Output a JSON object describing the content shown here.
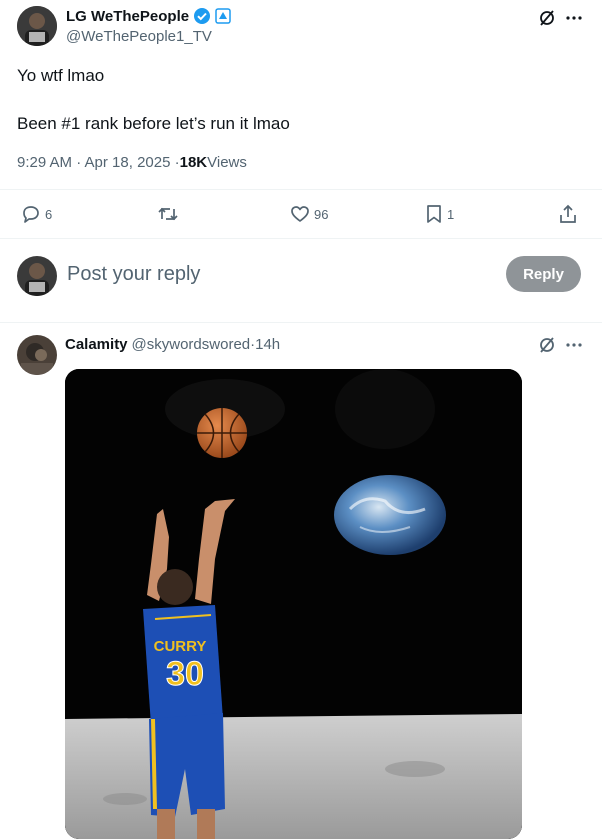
{
  "main_post": {
    "author_name": "LG WeThePeople",
    "author_handle": "@WeThePeople1_TV",
    "line1": "Yo wtf lmao",
    "line2": "Been #1 rank before let’s run it lmao",
    "time": "9:29 AM · Apr 18, 2025 · ",
    "views_count": "18K",
    "views_label": " Views",
    "stats": {
      "replies": "6",
      "likes": "96",
      "bookmarks": "1"
    }
  },
  "reply_box": {
    "placeholder": "Post your reply",
    "button_label": "Reply"
  },
  "reply_post": {
    "author_name": "Calamity",
    "author_handle": "@skywordswored",
    "dot": " · ",
    "time": "14h",
    "image": {
      "jersey_name": "CURRY",
      "jersey_number": "30"
    }
  },
  "colors": {
    "verified": "#1d9bf0",
    "muted": "#536471",
    "reply_button_bg": "#8f9498",
    "space_bg": "#000000"
  },
  "icons": [
    "verified-badge-icon",
    "affiliate-badge-icon",
    "grok-icon",
    "more-icon",
    "reply-icon",
    "repost-icon",
    "like-icon",
    "bookmark-icon",
    "share-icon"
  ]
}
